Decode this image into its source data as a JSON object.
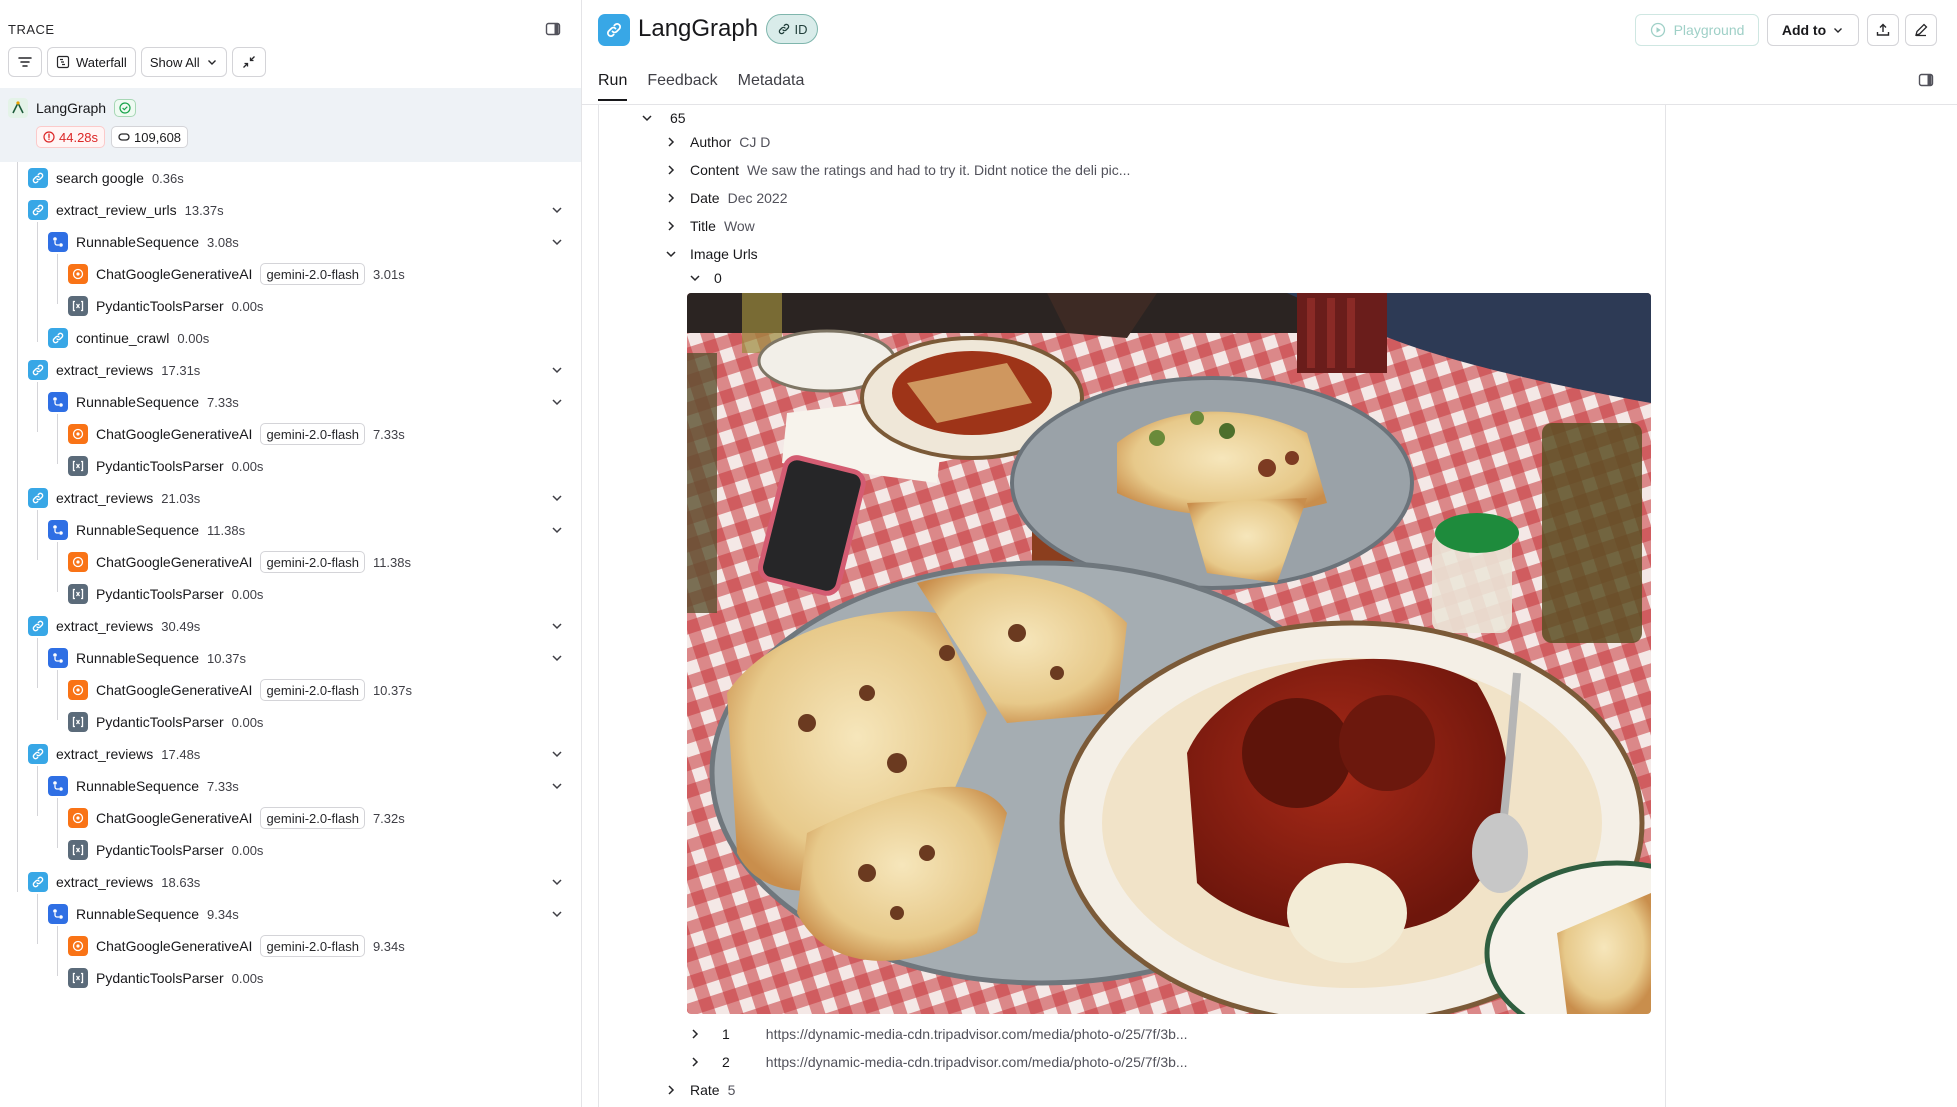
{
  "trace": {
    "title": "TRACE",
    "toolbar": {
      "view_label": "Waterfall",
      "filter_label": "Show All"
    },
    "root": {
      "name": "LangGraph",
      "latency": "44.28s",
      "tokens": "109,608"
    },
    "nodes": [
      {
        "name": "search google",
        "dur": "0.36s"
      },
      {
        "name": "extract_review_urls",
        "dur": "13.37s"
      },
      {
        "name": "RunnableSequence",
        "dur": "3.08s"
      },
      {
        "name": "ChatGoogleGenerativeAI",
        "model": "gemini-2.0-flash",
        "dur": "3.01s"
      },
      {
        "name": "PydanticToolsParser",
        "dur": "0.00s"
      },
      {
        "name": "continue_crawl",
        "dur": "0.00s"
      },
      {
        "name": "extract_reviews",
        "dur": "17.31s"
      },
      {
        "name": "RunnableSequence",
        "dur": "7.33s"
      },
      {
        "name": "ChatGoogleGenerativeAI",
        "model": "gemini-2.0-flash",
        "dur": "7.33s"
      },
      {
        "name": "PydanticToolsParser",
        "dur": "0.00s"
      },
      {
        "name": "extract_reviews",
        "dur": "21.03s"
      },
      {
        "name": "RunnableSequence",
        "dur": "11.38s"
      },
      {
        "name": "ChatGoogleGenerativeAI",
        "model": "gemini-2.0-flash",
        "dur": "11.38s"
      },
      {
        "name": "PydanticToolsParser",
        "dur": "0.00s"
      },
      {
        "name": "extract_reviews",
        "dur": "30.49s"
      },
      {
        "name": "RunnableSequence",
        "dur": "10.37s"
      },
      {
        "name": "ChatGoogleGenerativeAI",
        "model": "gemini-2.0-flash",
        "dur": "10.37s"
      },
      {
        "name": "PydanticToolsParser",
        "dur": "0.00s"
      },
      {
        "name": "extract_reviews",
        "dur": "17.48s"
      },
      {
        "name": "RunnableSequence",
        "dur": "7.33s"
      },
      {
        "name": "ChatGoogleGenerativeAI",
        "model": "gemini-2.0-flash",
        "dur": "7.32s"
      },
      {
        "name": "PydanticToolsParser",
        "dur": "0.00s"
      },
      {
        "name": "extract_reviews",
        "dur": "18.63s"
      },
      {
        "name": "RunnableSequence",
        "dur": "9.34s"
      },
      {
        "name": "ChatGoogleGenerativeAI",
        "model": "gemini-2.0-flash",
        "dur": "9.34s"
      },
      {
        "name": "PydanticToolsParser",
        "dur": "0.00s"
      }
    ]
  },
  "run": {
    "title": "LangGraph",
    "id_label": "ID",
    "playground_label": "Playground",
    "add_to_label": "Add to",
    "tabs": [
      "Run",
      "Feedback",
      "Metadata"
    ]
  },
  "review": {
    "index": "65",
    "fields": {
      "author_key": "Author",
      "author_val": "CJ D",
      "content_key": "Content",
      "content_val": "We saw the ratings and had to try it. Didnt notice the deli pic...",
      "date_key": "Date",
      "date_val": "Dec 2022",
      "title_key": "Title",
      "title_val": "Wow",
      "images_key": "Image Urls",
      "rate_key": "Rate",
      "rate_val": "5"
    },
    "images": [
      {
        "index": "0"
      },
      {
        "index": "1",
        "url": "https://dynamic-media-cdn.tripadvisor.com/media/photo-o/25/7f/3b..."
      },
      {
        "index": "2",
        "url": "https://dynamic-media-cdn.tripadvisor.com/media/photo-o/25/7f/3b..."
      }
    ]
  }
}
